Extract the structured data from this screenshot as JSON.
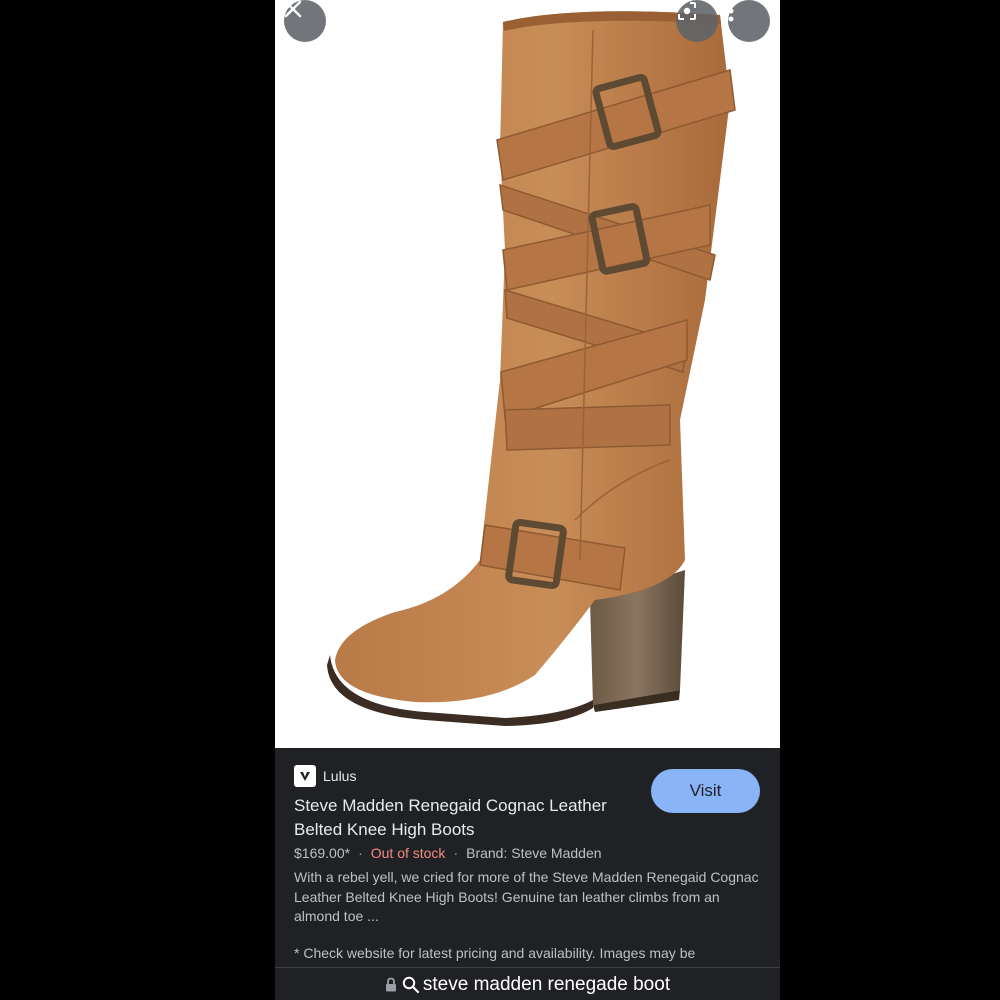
{
  "product": {
    "source": "Lulus",
    "title": "Steve Madden Renegaid Cognac Leather Belted Knee High Boots",
    "price": "$169.00*",
    "stock": "Out of stock",
    "brand": "Brand: Steve Madden",
    "description": "With a rebel yell, we cried for more of the Steve Madden Renegaid Cognac Leather Belted Knee High Boots! Genuine tan leather climbs from an almond toe ...",
    "disclaimer": "* Check website for latest pricing and availability. Images may be"
  },
  "actions": {
    "visit_label": "Visit"
  },
  "urlbar": {
    "query": "steve madden renegade boot"
  },
  "icons": {
    "close": "close-icon",
    "lens": "lens-icon",
    "more": "more-vert-icon",
    "lock": "lock-icon",
    "search": "search-icon",
    "favicon": "lulus-favicon"
  },
  "colors": {
    "accent": "#8ab4f8",
    "stock_status": "#f28b82",
    "panel_bg": "#202124"
  }
}
